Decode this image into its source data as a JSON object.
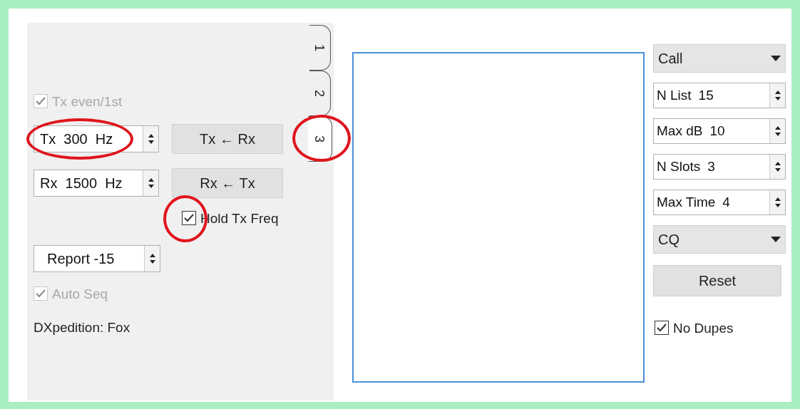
{
  "left_panel": {
    "tx_even": {
      "label": "Tx even/1st",
      "checked": true,
      "disabled": true
    },
    "tx_freq": {
      "value": "Tx  300  Hz",
      "circled": true
    },
    "tx_from_rx_button": "Tx ← Rx",
    "rx_freq": {
      "value": "Rx  1500  Hz"
    },
    "rx_from_tx_button": "Rx ← Tx",
    "hold_tx_freq": {
      "label": "Hold Tx Freq",
      "checked": true,
      "disabled": false,
      "circled": true
    },
    "report": {
      "value": "Report -15"
    },
    "auto_seq": {
      "label": "Auto Seq",
      "checked": true,
      "disabled": true
    },
    "mode_label": "DXpedition: Fox"
  },
  "tabs": [
    {
      "label": "1",
      "selected": false,
      "circled": false
    },
    {
      "label": "2",
      "selected": false,
      "circled": false
    },
    {
      "label": "3",
      "selected": true,
      "circled": true
    }
  ],
  "right_panel": {
    "controls": [
      {
        "kind": "dropdown",
        "value": "Call"
      },
      {
        "kind": "spin",
        "label": "N List",
        "value": "15"
      },
      {
        "kind": "spin",
        "label": "Max dB",
        "value": "10"
      },
      {
        "kind": "spin",
        "label": "N Slots",
        "value": "3"
      },
      {
        "kind": "spin",
        "label": "Max Time",
        "value": "4"
      },
      {
        "kind": "dropdown",
        "value": "CQ"
      },
      {
        "kind": "button",
        "label": "Reset"
      }
    ],
    "no_dupes": {
      "label": "No Dupes",
      "checked": true,
      "disabled": false
    }
  }
}
